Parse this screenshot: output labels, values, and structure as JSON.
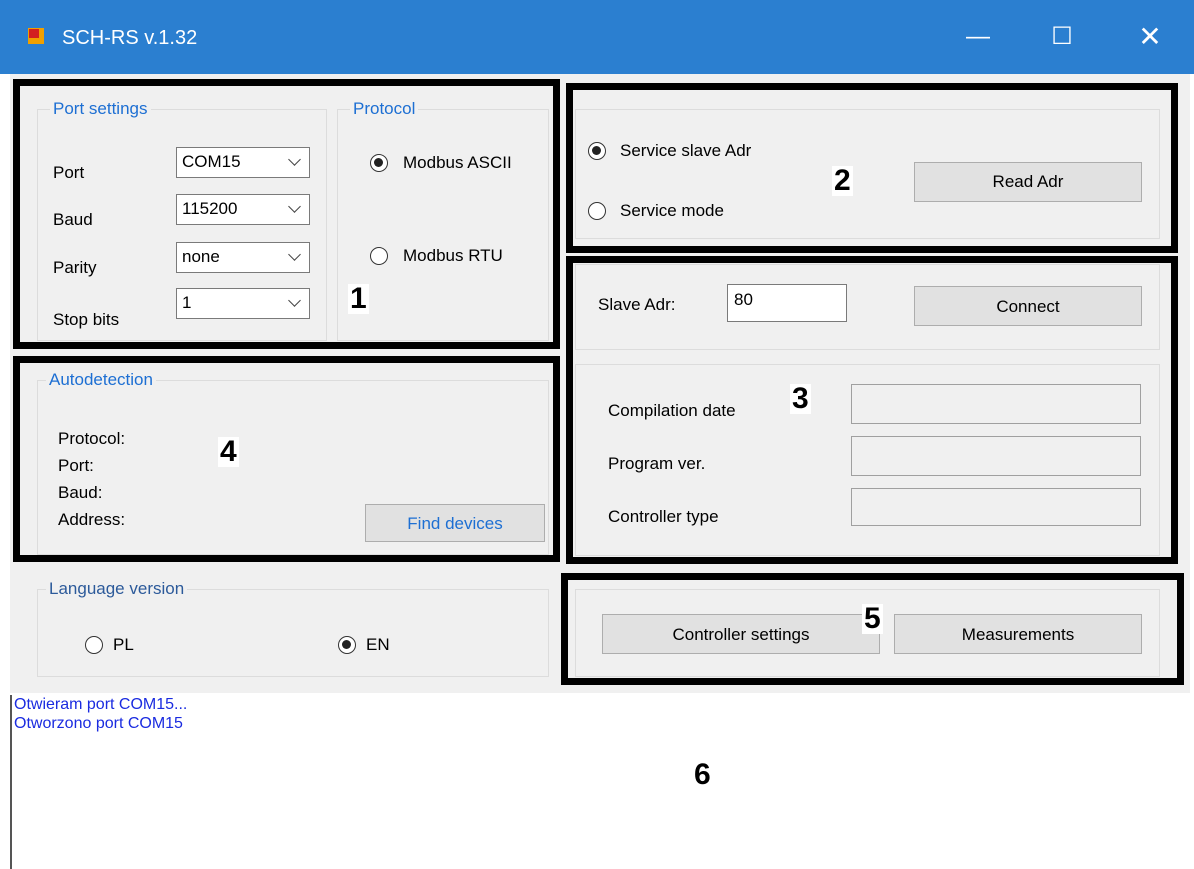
{
  "window": {
    "title": "SCH-RS v.1.32",
    "minimize_glyph": "—",
    "maximize_glyph": "☐",
    "close_glyph": "✕"
  },
  "port_settings": {
    "title": "Port settings",
    "port_label": "Port",
    "port_value": "COM15",
    "baud_label": "Baud",
    "baud_value": "115200",
    "parity_label": "Parity",
    "parity_value": "none",
    "stopbits_label": "Stop bits",
    "stopbits_value": "1"
  },
  "protocol": {
    "title": "Protocol",
    "ascii_label": "Modbus ASCII",
    "ascii_selected": true,
    "rtu_label": "Modbus RTU",
    "rtu_selected": false
  },
  "service": {
    "slave_adr_label": "Service slave Adr",
    "slave_adr_selected": true,
    "mode_label": "Service mode",
    "mode_selected": false,
    "read_adr_button": "Read Adr"
  },
  "connection": {
    "slave_adr_label": "Slave Adr:",
    "slave_adr_value": "80",
    "connect_button": "Connect",
    "compilation_date_label": "Compilation date",
    "program_ver_label": "Program ver.",
    "controller_type_label": "Controller type"
  },
  "autodetection": {
    "title": "Autodetection",
    "protocol_label": "Protocol:",
    "port_label": "Port:",
    "baud_label": "Baud:",
    "address_label": "Address:",
    "find_button": "Find devices"
  },
  "language": {
    "title": "Language version",
    "pl_label": "PL",
    "pl_selected": false,
    "en_label": "EN",
    "en_selected": true
  },
  "actions": {
    "controller_settings_button": "Controller settings",
    "measurements_button": "Measurements"
  },
  "log": {
    "lines": [
      "Otwieram port COM15...",
      "Otworzono port COM15"
    ]
  },
  "annotations": [
    "1",
    "2",
    "3",
    "4",
    "5",
    "6"
  ],
  "colors": {
    "titlebar": "#2b7fd0",
    "group_title": "#1d6fd3",
    "log_text": "#1a2be0",
    "frame": "#000000"
  }
}
